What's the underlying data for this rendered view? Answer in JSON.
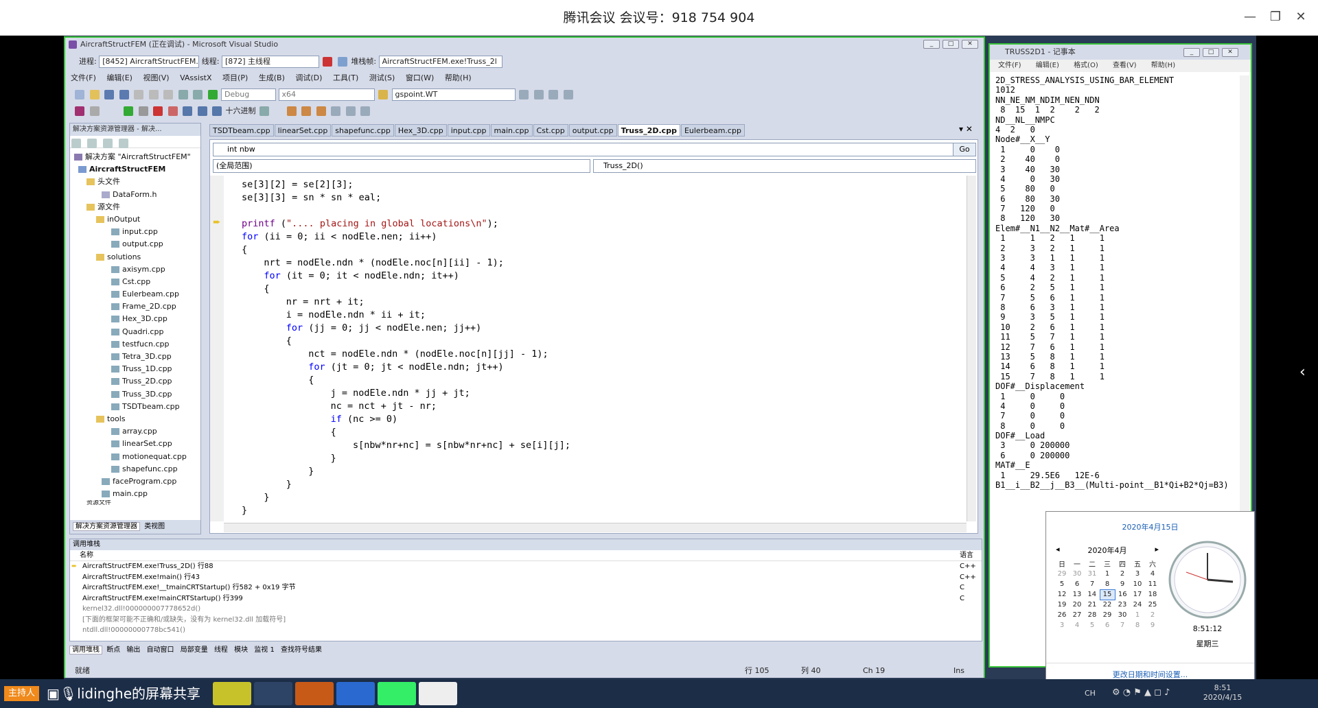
{
  "meeting": {
    "title": "腾讯会议 会议号：918 754 904"
  },
  "vs": {
    "title": "AircraftStructFEM (正在调试) - Microsoft Visual Studio",
    "debug_bar": {
      "process_label": "进程:",
      "process_value": "[8452] AircraftStructFEM.",
      "thread_label": "线程:",
      "thread_value": "[872] 主线程",
      "stackframe_label": "堆栈帧:",
      "stackframe_value": "AircraftStructFEM.exe!Truss_2l"
    },
    "menu": [
      "文件(F)",
      "编辑(E)",
      "视图(V)",
      "VAssistX",
      "项目(P)",
      "生成(B)",
      "调试(D)",
      "工具(T)",
      "测试(S)",
      "窗口(W)",
      "帮助(H)"
    ],
    "config": "Debug",
    "platform": "x64",
    "find_box": "gspoint.WT",
    "hex_button": "十六进制",
    "solution_explorer": {
      "header": "解决方案资源管理器 - 解决...",
      "solution": "解决方案 \"AircraftStructFEM\"",
      "project": "AircraftStructFEM",
      "headers_folder": "头文件",
      "dataform": "DataForm.h",
      "source_folder": "源文件",
      "inoutput": "inOutput",
      "inoutput_files": [
        "input.cpp",
        "output.cpp"
      ],
      "solutions": "solutions",
      "solutions_files": [
        "axisym.cpp",
        "Cst.cpp",
        "Eulerbeam.cpp",
        "Frame_2D.cpp",
        "Hex_3D.cpp",
        "Quadri.cpp",
        "testfucn.cpp",
        "Tetra_3D.cpp",
        "Truss_1D.cpp",
        "Truss_2D.cpp",
        "Truss_3D.cpp",
        "TSDTbeam.cpp"
      ],
      "tools": "tools",
      "tools_files": [
        "array.cpp",
        "linearSet.cpp",
        "motionequat.cpp",
        "shapefunc.cpp"
      ],
      "root_files": [
        "faceProgram.cpp",
        "main.cpp"
      ],
      "resource_folder": "资源文件",
      "bottom_tabs": [
        "解决方案资源管理器",
        "类视图"
      ]
    },
    "tabs": [
      "TSDTbeam.cpp",
      "linearSet.cpp",
      "shapefunc.cpp",
      "Hex_3D.cpp",
      "input.cpp",
      "main.cpp",
      "Cst.cpp",
      "output.cpp",
      "Truss_2D.cpp",
      "Eulerbeam.cpp"
    ],
    "active_tab": "Truss_2D.cpp",
    "nav": {
      "symbol": "int nbw",
      "go": "Go",
      "scope": "(全局范围)",
      "function": "Truss_2D()"
    },
    "code": [
      "se[3][2] = se[2][3];",
      "se[3][3] = sn * sn * eal;",
      "",
      "printf (\".... placing in global locations\\n\");",
      "for (ii = 0; ii < nodEle.nen; ii++)",
      "{",
      "nrt = nodEle.ndn * (nodEle.noc[n][ii] - 1);",
      "for (it = 0; it < nodEle.ndn; it++)",
      "{",
      "nr = nrt + it;",
      "i = nodEle.ndn * ii + it;",
      "for (jj = 0; jj < nodEle.nen; jj++)",
      "{",
      "nct = nodEle.ndn * (nodEle.noc[n][jj] - 1);",
      "for (jt = 0; jt < nodEle.ndn; jt++)",
      "{",
      "j = nodEle.ndn * jj + jt;",
      "nc = nct + jt - nr;",
      "if (nc >= 0)",
      "{",
      "s[nbw*nr+nc] = s[nbw*nr+nc] + se[i][j];",
      "}",
      "}",
      "}",
      "}",
      "}"
    ],
    "callstack": {
      "header": "调用堆栈",
      "col_name": "名称",
      "col_lang": "语言",
      "rows": [
        {
          "name": "AircraftStructFEM.exe!Truss_2D() 行88",
          "lang": "C++"
        },
        {
          "name": "AircraftStructFEM.exe!main() 行43",
          "lang": "C++"
        },
        {
          "name": "AircraftStructFEM.exe!__tmainCRTStartup() 行582 + 0x19 字节",
          "lang": "C"
        },
        {
          "name": "AircraftStructFEM.exe!mainCRTStartup() 行399",
          "lang": "C"
        },
        {
          "name": "kernel32.dll!000000007778652d()",
          "lang": ""
        },
        {
          "name": "[下面的框架可能不正确和/或缺失，没有为 kernel32.dll 加载符号]",
          "lang": ""
        },
        {
          "name": "ntdll.dll!00000000778bc541()",
          "lang": ""
        }
      ]
    },
    "bottom_tabs": [
      "调用堆栈",
      "断点",
      "输出",
      "自动窗口",
      "局部变量",
      "线程",
      "模块",
      "监视 1",
      "查找符号结果"
    ],
    "status": {
      "ready": "就绪",
      "line": "行 105",
      "col": "列 40",
      "ch": "Ch 19",
      "ins": "Ins"
    }
  },
  "notepad": {
    "title": "TRUSS2D1 - 记事本",
    "menu": [
      "文件(F)",
      "编辑(E)",
      "格式(O)",
      "查看(V)",
      "帮助(H)"
    ],
    "lines": [
      "2D_STRESS_ANALYSIS_USING_BAR_ELEMENT",
      "1012",
      "NN_NE_NM_NDIM_NEN_NDN",
      " 8  15  1  2    2   2",
      "ND__NL__NMPC",
      "4  2   0",
      "Node#__X__Y",
      " 1     0    0",
      " 2    40    0",
      " 3    40   30",
      " 4     0   30",
      " 5    80   0",
      " 6    80   30",
      " 7   120   0",
      " 8   120   30",
      "Elem#__N1__N2__Mat#__Area",
      " 1     1   2   1     1",
      " 2     3   2   1     1",
      " 3     3   1   1     1",
      " 4     4   3   1     1",
      " 5     4   2   1     1",
      " 6     2   5   1     1",
      " 7     5   6   1     1",
      " 8     6   3   1     1",
      " 9     3   5   1     1",
      " 10    2   6   1     1",
      " 11    5   7   1     1",
      " 12    7   6   1     1",
      " 13    5   8   1     1",
      " 14    6   8   1     1",
      " 15    7   8   1     1",
      "DOF#__Displacement",
      " 1     0     0",
      " 4     0     0",
      " 7     0     0",
      " 8     0     0",
      "DOF#__Load",
      " 3     0 200000",
      " 6     0 200000",
      "MAT#__E",
      " 1     29.5E6   12E-6",
      "B1__i__B2__j__B3__(Multi-point__B1*Qi+B2*Qj=B3)"
    ]
  },
  "clock": {
    "date_header": "2020年4月15日",
    "month": "2020年4月",
    "weekdays": [
      "日",
      "一",
      "二",
      "三",
      "四",
      "五",
      "六"
    ],
    "weeks": [
      [
        "29",
        "30",
        "31",
        "1",
        "2",
        "3",
        "4"
      ],
      [
        "5",
        "6",
        "7",
        "8",
        "9",
        "10",
        "11"
      ],
      [
        "12",
        "13",
        "14",
        "15",
        "16",
        "17",
        "18"
      ],
      [
        "19",
        "20",
        "21",
        "22",
        "23",
        "24",
        "25"
      ],
      [
        "26",
        "27",
        "28",
        "29",
        "30",
        "1",
        "2"
      ],
      [
        "3",
        "4",
        "5",
        "6",
        "7",
        "8",
        "9"
      ]
    ],
    "time": "8:51:12",
    "weekday": "星期三",
    "change_link": "更改日期和时间设置..."
  },
  "taskbar": {
    "host_badge": "主持人",
    "share_label": "lidinghe的屏幕共享",
    "tray_lang": "CH",
    "tray_time": "8:51",
    "tray_date": "2020/4/15"
  }
}
